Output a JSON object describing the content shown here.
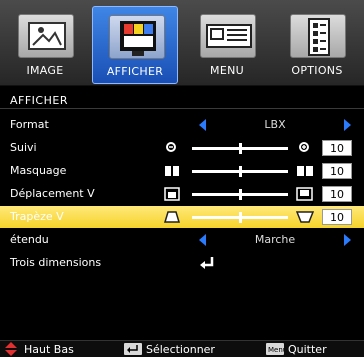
{
  "tabs": [
    {
      "label": "IMAGE",
      "icon": "image-frame-icon",
      "active": false
    },
    {
      "label": "AFFICHER",
      "icon": "display-icon",
      "active": true
    },
    {
      "label": "MENU",
      "icon": "menu-monitor-icon",
      "active": false
    },
    {
      "label": "OPTIONS",
      "icon": "options-document-icon",
      "active": false
    }
  ],
  "section_title": "AFFICHER",
  "rows": {
    "format": {
      "label": "Format",
      "value": "LBX"
    },
    "suivi": {
      "label": "Suivi",
      "value": "10",
      "level": 0.5
    },
    "masquage": {
      "label": "Masquage",
      "value": "10",
      "level": 0.5
    },
    "deplacement": {
      "label": "Déplacement V",
      "value": "10",
      "level": 0.5
    },
    "trapeze": {
      "label": "Trapèze V",
      "value": "10",
      "level": 0.5,
      "selected": true
    },
    "etendu": {
      "label": "étendu",
      "value": "Marche"
    },
    "trois": {
      "label": "Trois dimensions"
    }
  },
  "footer": {
    "nav": "Haut Bas",
    "select": "Sélectionner",
    "quit": "Quitter",
    "menu_key": "Menu"
  },
  "colors": {
    "accent_blue": "#2b7bff",
    "selected_row": "#f6d32a",
    "nav_red": "#e03030"
  }
}
